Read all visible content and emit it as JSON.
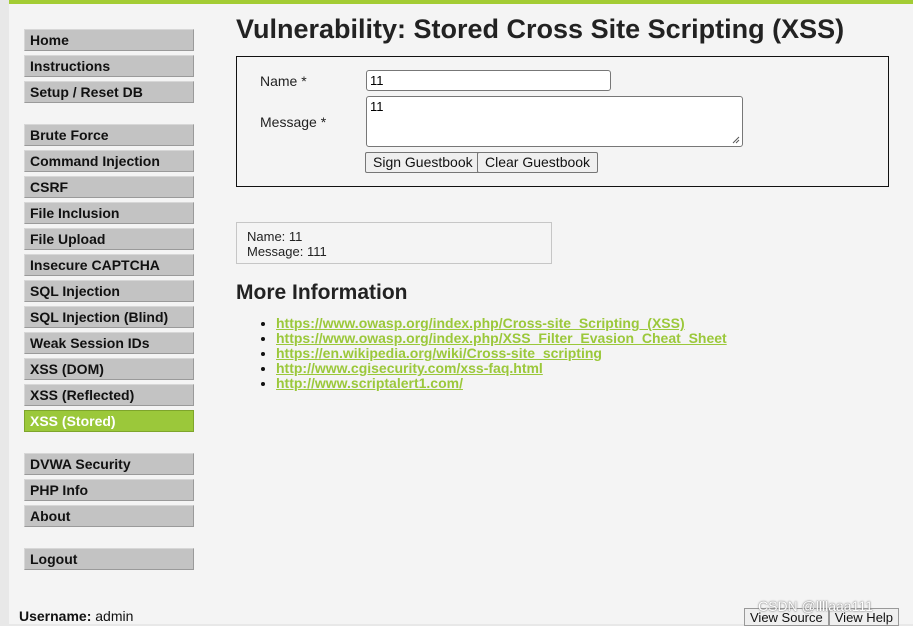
{
  "page": {
    "title": "Vulnerability: Stored Cross Site Scripting (XSS)",
    "accent_color": "#9bc83a"
  },
  "sidebar": {
    "groups": [
      {
        "items": [
          {
            "label": "Home"
          },
          {
            "label": "Instructions"
          },
          {
            "label": "Setup / Reset DB"
          }
        ]
      },
      {
        "items": [
          {
            "label": "Brute Force"
          },
          {
            "label": "Command Injection"
          },
          {
            "label": "CSRF"
          },
          {
            "label": "File Inclusion"
          },
          {
            "label": "File Upload"
          },
          {
            "label": "Insecure CAPTCHA"
          },
          {
            "label": "SQL Injection"
          },
          {
            "label": "SQL Injection (Blind)"
          },
          {
            "label": "Weak Session IDs"
          },
          {
            "label": "XSS (DOM)"
          },
          {
            "label": "XSS (Reflected)"
          },
          {
            "label": "XSS (Stored)",
            "active": true
          }
        ]
      },
      {
        "items": [
          {
            "label": "DVWA Security"
          },
          {
            "label": "PHP Info"
          },
          {
            "label": "About"
          }
        ]
      },
      {
        "items": [
          {
            "label": "Logout"
          }
        ]
      }
    ]
  },
  "form": {
    "name_label": "Name *",
    "name_value": "11",
    "message_label": "Message *",
    "message_value": "11",
    "sign_button": "Sign Guestbook",
    "clear_button": "Clear Guestbook"
  },
  "entry": {
    "name_line": "Name: 11",
    "message_line": "Message: 111"
  },
  "more_info": {
    "heading": "More Information",
    "links": [
      "https://www.owasp.org/index.php/Cross-site_Scripting_(XSS)",
      "https://www.owasp.org/index.php/XSS_Filter_Evasion_Cheat_Sheet",
      "https://en.wikipedia.org/wiki/Cross-site_scripting",
      "http://www.cgisecurity.com/xss-faq.html",
      "http://www.scriptalert1.com/"
    ]
  },
  "footer": {
    "username_label": "Username:",
    "username_value": "admin",
    "view_source": "View Source",
    "view_help": "View Help",
    "watermark": "CSDN @llllaaa111"
  }
}
